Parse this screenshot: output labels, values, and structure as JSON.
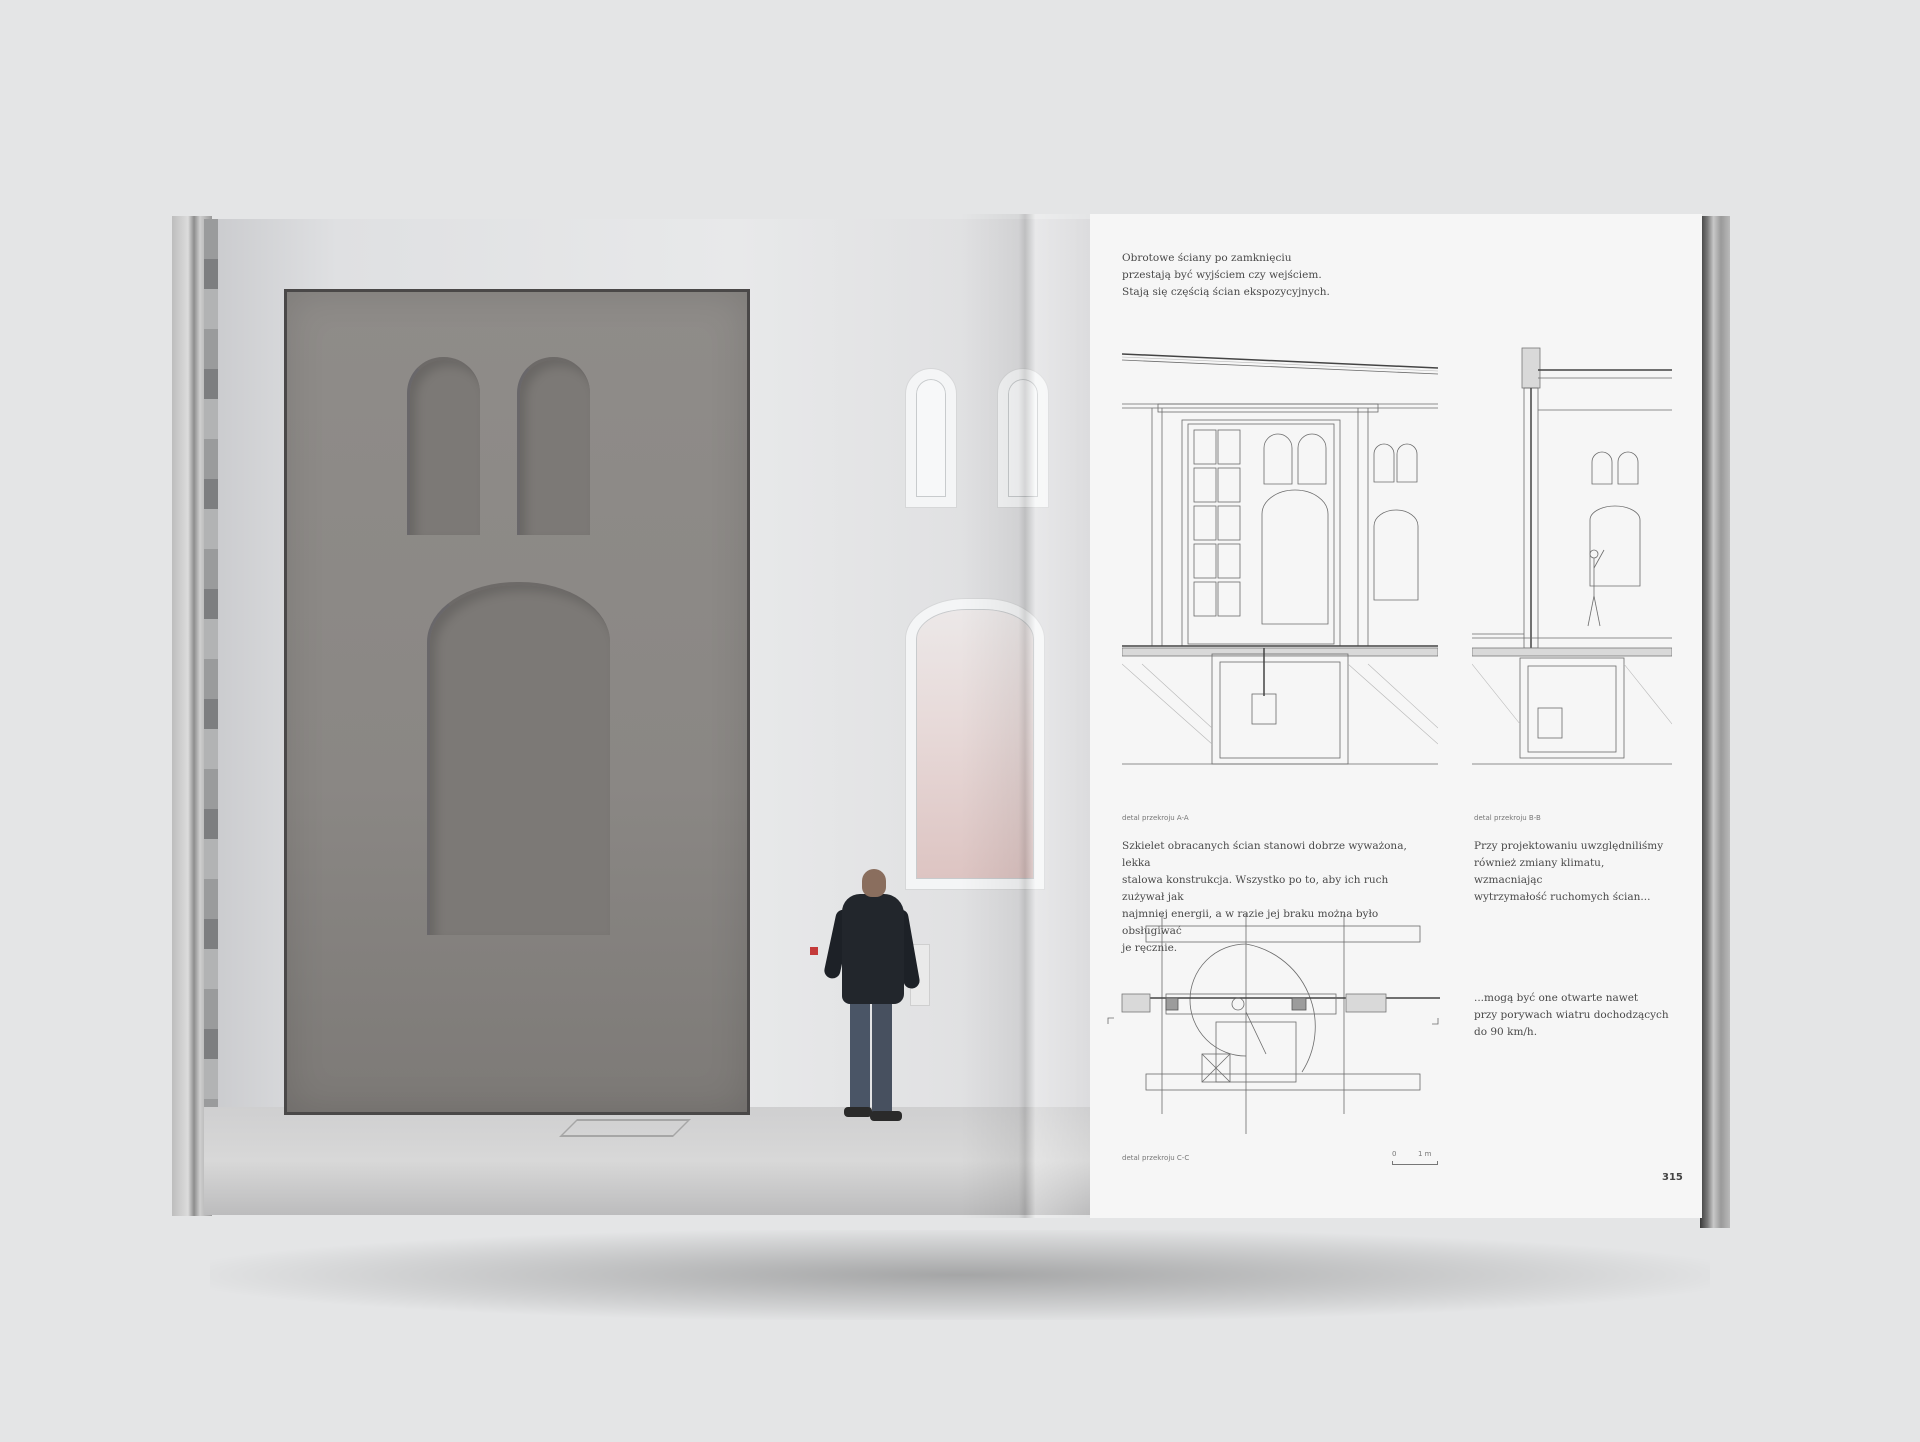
{
  "right_page": {
    "intro": [
      "Obrotowe ściany po zamknięciu",
      "przestają być wyjściem czy wejściem.",
      "Stają się częścią ścian ekspozycyjnych."
    ],
    "caption_a": "detal przekroju A-A",
    "caption_b": "detal przekroju B-B",
    "caption_c": "detal przekroju C-C",
    "paragraph_1": [
      "Szkielet obracanych ścian stanowi dobrze wyważona, lekka",
      "stalowa konstrukcja. Wszystko po to, aby ich ruch zużywał jak",
      "najmniej energii, a w razie jej braku można było obsługiwać",
      "je ręcznie."
    ],
    "paragraph_2": [
      "Przy projektowaniu uwzględniliśmy",
      "również zmiany klimatu, wzmacniając",
      "wytrzymałość ruchomych ścian..."
    ],
    "paragraph_3": [
      "...mogą być one otwarte nawet",
      "przy porywach wiatru dochodzących",
      "do 90 km/h."
    ],
    "scale_zero": "0",
    "scale_unit": "1 m",
    "page_number": "315"
  }
}
